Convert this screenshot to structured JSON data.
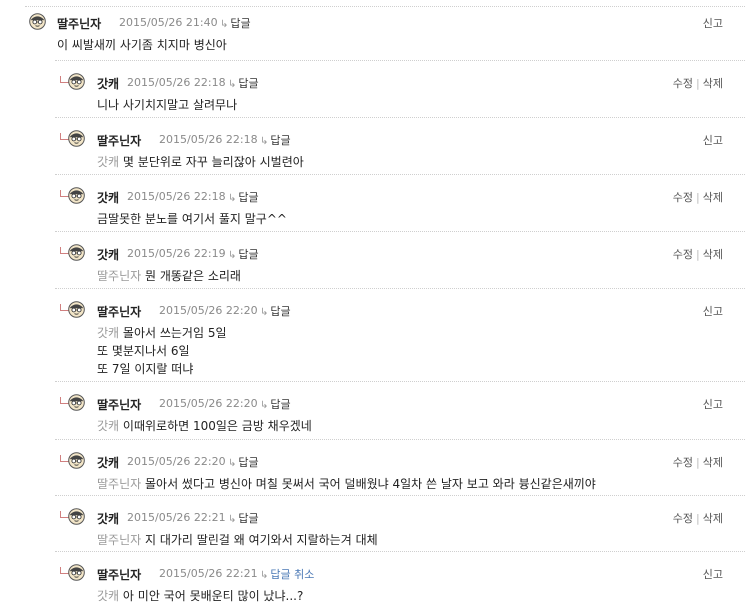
{
  "labels": {
    "reply": "답글",
    "reply_cancel": "답글 취소",
    "report": "신고",
    "edit": "수정",
    "delete": "삭제",
    "separator": "|"
  },
  "comments": [
    {
      "nick": "딸주닌자",
      "date": "2015/05/26 21:40",
      "mention": "",
      "lines": [
        "이 씨발새끼 사기좀 치지마 병신아"
      ],
      "own": false
    },
    {
      "nick": "갓캐",
      "date": "2015/05/26 22:18",
      "mention": "",
      "lines": [
        "니나 사기치지말고 살려무나"
      ],
      "own": true
    },
    {
      "nick": "딸주닌자",
      "date": "2015/05/26 22:18",
      "mention": "갓캐",
      "lines": [
        "몇 분단위로 자꾸 늘리잖아 시벌련아"
      ],
      "own": false
    },
    {
      "nick": "갓캐",
      "date": "2015/05/26 22:18",
      "mention": "",
      "lines": [
        "금딸못한 분노를 여기서 풀지 말구^^"
      ],
      "own": true
    },
    {
      "nick": "갓캐",
      "date": "2015/05/26 22:19",
      "mention": "딸주닌자",
      "lines": [
        "뭔 개똥같은 소리래"
      ],
      "own": true
    },
    {
      "nick": "딸주닌자",
      "date": "2015/05/26 22:20",
      "mention": "갓캐",
      "lines": [
        "몰아서 쓰는거임 5일",
        "또 몇분지나서 6일",
        "또 7일 이지랄 떠냐"
      ],
      "own": false
    },
    {
      "nick": "딸주닌자",
      "date": "2015/05/26 22:20",
      "mention": "갓캐",
      "lines": [
        "이때위로하면 100일은 금방 채우겠네"
      ],
      "own": false
    },
    {
      "nick": "갓캐",
      "date": "2015/05/26 22:20",
      "mention": "딸주닌자",
      "lines": [
        "몰아서 썼다고 병신아 며칠 못써서 국어 덜배웠냐 4일차 쓴 날자 보고 와라 븅신같은새끼야"
      ],
      "own": true
    },
    {
      "nick": "갓캐",
      "date": "2015/05/26 22:21",
      "mention": "딸주닌자",
      "lines": [
        "지 대가리 딸린걸 왜 여기와서 지랄하는겨 대체"
      ],
      "own": true
    },
    {
      "nick": "딸주닌자",
      "date": "2015/05/26 22:21",
      "mention": "갓캐",
      "lines": [
        "아 미안 국어 못배운티 많이 났냐...?"
      ],
      "own": false,
      "replying": true
    }
  ]
}
